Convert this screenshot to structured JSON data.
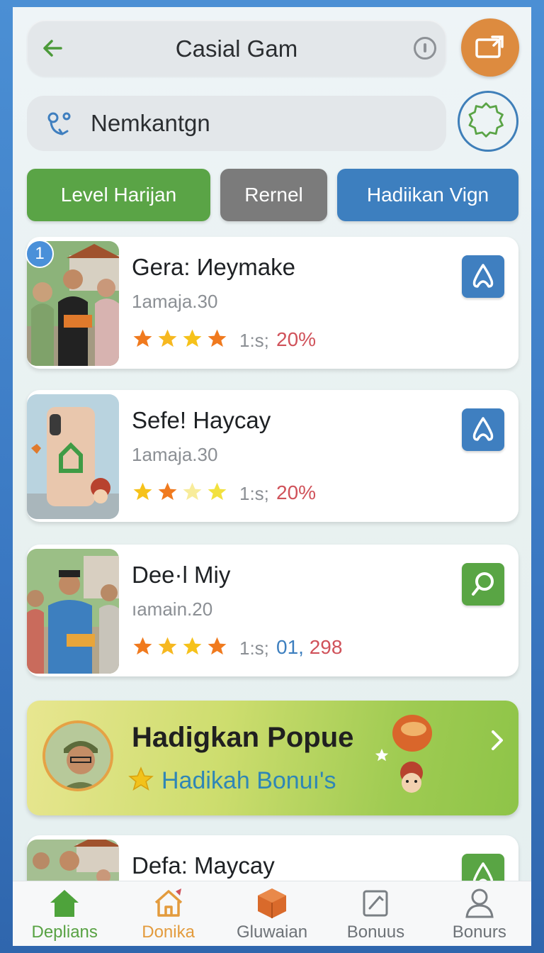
{
  "header": {
    "title": "Casial Gam",
    "back_icon": "arrow-left-icon",
    "info_icon": "info-icon",
    "share_icon": "share-icon"
  },
  "search": {
    "value": "Nemkantgn",
    "placeholder": "Nemkantgn",
    "icon": "location-route-icon",
    "settings_icon": "badge-gear-icon"
  },
  "filters": [
    {
      "label": "Level Harijan",
      "color": "#5aa446"
    },
    {
      "label": "Rernel",
      "color": "#7b7b7b"
    },
    {
      "label": "Hadiikan Vign",
      "color": "#3d7fbf"
    }
  ],
  "cards": [
    {
      "rank": "1",
      "title": "Gera: Иeymake",
      "subtitle": "1amaja.30",
      "rating": 4,
      "meta_a": "1:s;",
      "meta_b": "20%",
      "action_icon": "drop-icon"
    },
    {
      "title": "Sefe! Haycay",
      "subtitle": "1amaja.30",
      "rating": 4,
      "meta_a": "1:s;",
      "meta_b": "20%",
      "action_icon": "drop-icon"
    },
    {
      "title": "Dee·l Miy",
      "subtitle": "ıamain.20",
      "rating": 4,
      "meta_a": "1:s;",
      "meta_b_blue": "01,",
      "meta_b": "298",
      "action_icon": "search-icon"
    },
    {
      "title": "Defa: Maycay",
      "action_icon": "drop-icon"
    }
  ],
  "promo": {
    "title": "Hadigkan Popue",
    "subtitle": "Hadikah Bonuı's",
    "star_icon": "star-icon",
    "chevron_icon": "chevron-right-icon"
  },
  "nav": [
    {
      "label": "Deplians",
      "icon": "home-icon",
      "color": "#58a243"
    },
    {
      "label": "Donika",
      "icon": "house-outline-icon",
      "color": "#e39b3d"
    },
    {
      "label": "Gluwaian",
      "icon": "box-icon",
      "color": "#6d7277"
    },
    {
      "label": "Bonuus",
      "icon": "edit-icon",
      "color": "#6d7277"
    },
    {
      "label": "Bonurs",
      "icon": "user-icon",
      "color": "#6d7277"
    }
  ],
  "colors": {
    "accent_green": "#5aa446",
    "accent_blue": "#3d7fbf",
    "accent_orange": "#dd8b3f",
    "stat_red": "#d0525a"
  }
}
